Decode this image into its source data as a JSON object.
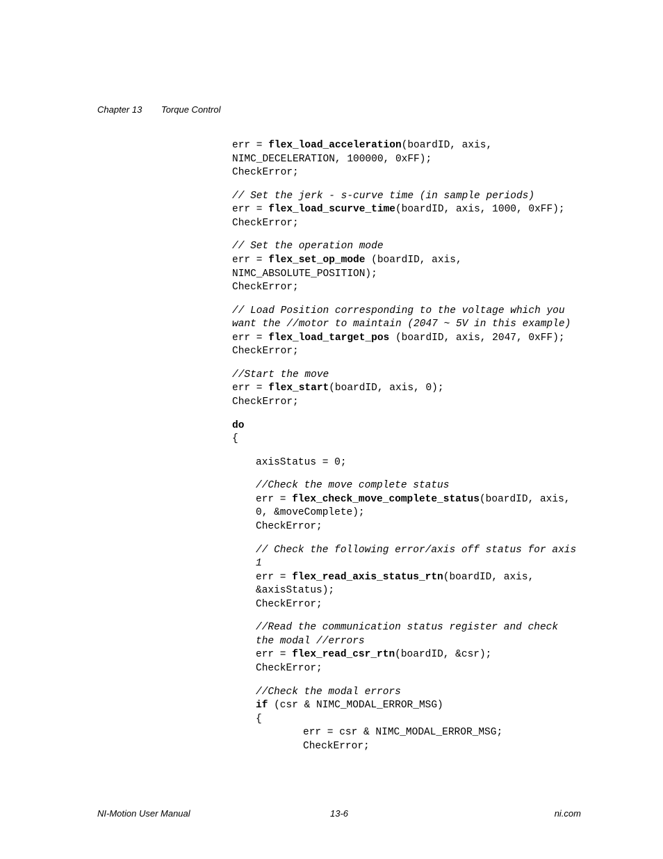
{
  "header": {
    "chapter": "Chapter 13",
    "title": "Torque Control"
  },
  "code": {
    "b1_l1_pre": "err = ",
    "b1_l1_fn": "flex_load_acceleration",
    "b1_l1_post": "(boardID, axis, NIMC_DECELERATION, 100000, 0xFF);",
    "b1_l2": "CheckError;",
    "b2_c1": "// Set the jerk - s-curve time (in sample periods)",
    "b2_l1_pre": "err = ",
    "b2_l1_fn": "flex_load_scurve_time",
    "b2_l1_post": "(boardID, axis, 1000, 0xFF);",
    "b2_l2": "CheckError;",
    "b3_c1": "// Set the operation mode",
    "b3_l1_pre": "err = ",
    "b3_l1_fn": "flex_set_op_mode",
    "b3_l1_post": " (boardID, axis, NIMC_ABSOLUTE_POSITION);",
    "b3_l2": "CheckError;",
    "b4_c1": "// Load Position corresponding to the voltage which you want the //motor to maintain (2047 ~ 5V in this example)",
    "b4_l1_pre": "err = ",
    "b4_l1_fn": "flex_load_target_pos",
    "b4_l1_post": " (boardID, axis, 2047, 0xFF);",
    "b4_l2": "CheckError;",
    "b5_c1": "//Start the move",
    "b5_l1_pre": "err = ",
    "b5_l1_fn": "flex_start",
    "b5_l1_post": "(boardID, axis, 0);",
    "b5_l2": "CheckError;",
    "b6_do": "do",
    "b6_brace": "{",
    "b7_l1": "axisStatus = 0;",
    "b8_c1": "//Check the move complete status",
    "b8_l1_pre": "err = ",
    "b8_l1_fn": "flex_check_move_complete_status",
    "b8_l1_post": "(boardID, axis, 0, &moveComplete);",
    "b8_l2": "CheckError;",
    "b9_c1": "// Check the following error/axis off status for axis 1",
    "b9_l1_pre": "err = ",
    "b9_l1_fn": "flex_read_axis_status_rtn",
    "b9_l1_post": "(boardID, axis, &axisStatus);",
    "b9_l2": "CheckError;",
    "b10_c1": "//Read the communication status register and check the modal //errors",
    "b10_l1_pre": "err = ",
    "b10_l1_fn": "flex_read_csr_rtn",
    "b10_l1_post": "(boardID, &csr);",
    "b10_l2": "CheckError;",
    "b11_c1": "//Check the modal errors",
    "b11_if": "if",
    "b11_cond": " (csr & NIMC_MODAL_ERROR_MSG)",
    "b11_brace": "{",
    "b11_l1": "err = csr & NIMC_MODAL_ERROR_MSG;",
    "b11_l2": "CheckError;"
  },
  "footer": {
    "left": "NI-Motion User Manual",
    "center": "13-6",
    "right": "ni.com"
  }
}
